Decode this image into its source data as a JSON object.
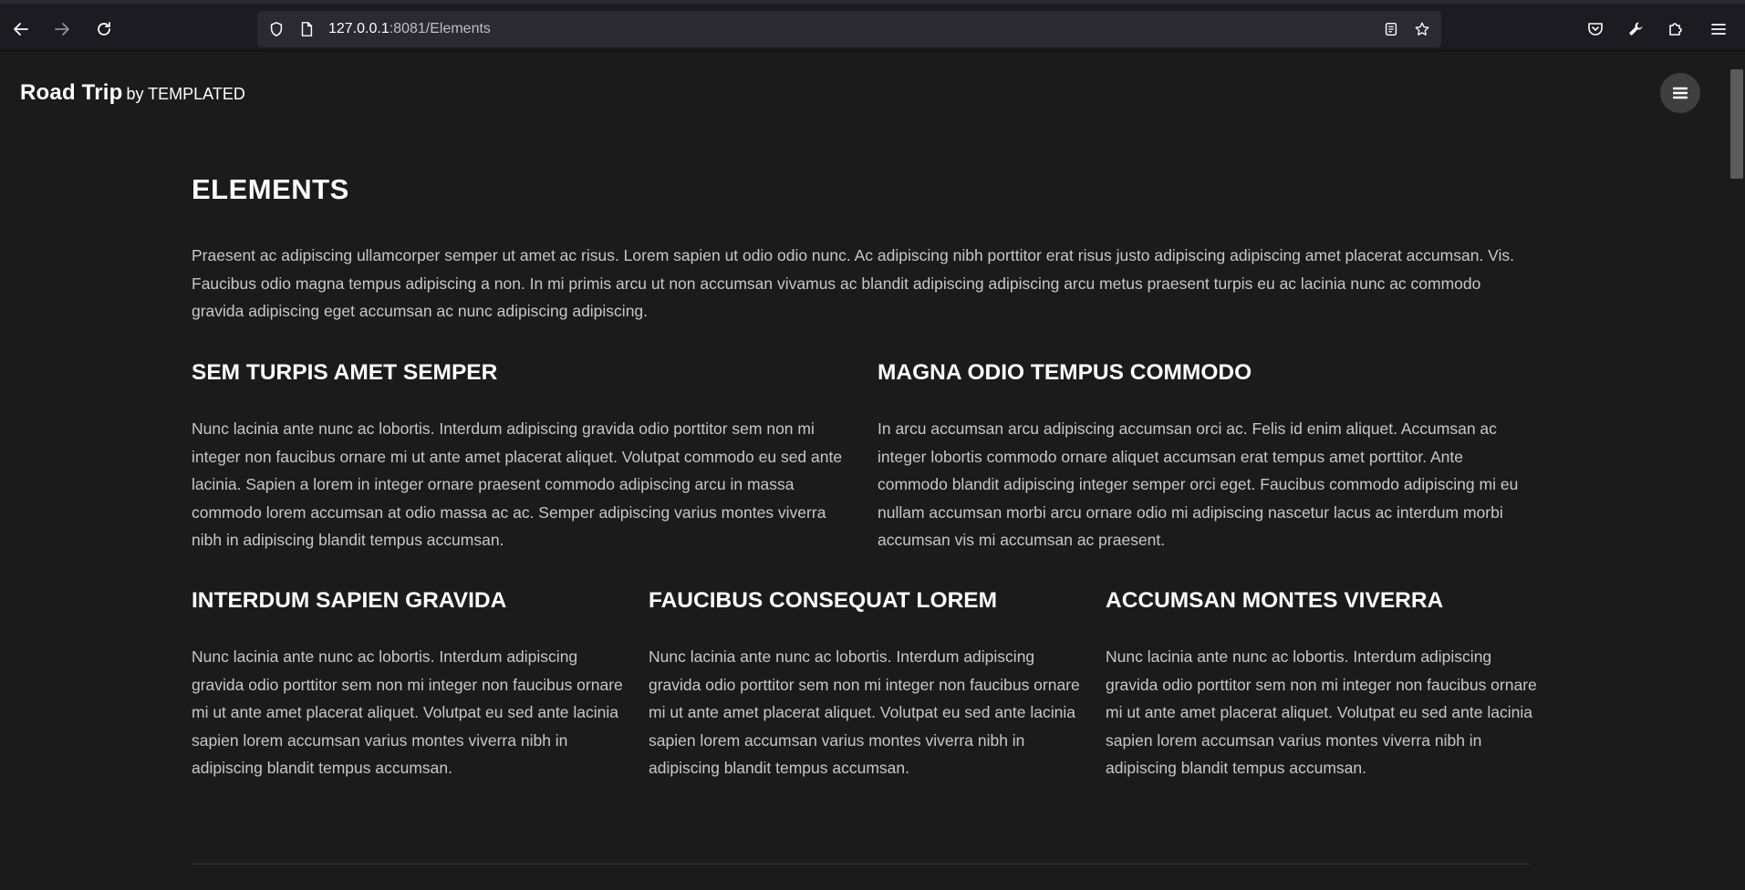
{
  "browser": {
    "url_host": "127.0.0.1",
    "url_rest": ":8081/Elements"
  },
  "site": {
    "brand_name": "Road Trip",
    "brand_by": "by TEMPLATED"
  },
  "main": {
    "title": "ELEMENTS",
    "intro": "Praesent ac adipiscing ullamcorper semper ut amet ac risus. Lorem sapien ut odio odio nunc. Ac adipiscing nibh porttitor erat risus justo adipiscing adipiscing amet placerat accumsan. Vis. Faucibus odio magna tempus adipiscing a non. In mi primis arcu ut non accumsan vivamus ac blandit adipiscing adipiscing arcu metus praesent turpis eu ac lacinia nunc ac commodo gravida adipiscing eget accumsan ac nunc adipiscing adipiscing.",
    "two_col": [
      {
        "title": "SEM TURPIS AMET SEMPER",
        "text": "Nunc lacinia ante nunc ac lobortis. Interdum adipiscing gravida odio porttitor sem non mi integer non faucibus ornare mi ut ante amet placerat aliquet. Volutpat commodo eu sed ante lacinia. Sapien a lorem in integer ornare praesent commodo adipiscing arcu in massa commodo lorem accumsan at odio massa ac ac. Semper adipiscing varius montes viverra nibh in adipiscing blandit tempus accumsan."
      },
      {
        "title": "MAGNA ODIO TEMPUS COMMODO",
        "text": "In arcu accumsan arcu adipiscing accumsan orci ac. Felis id enim aliquet. Accumsan ac integer lobortis commodo ornare aliquet accumsan erat tempus amet porttitor. Ante commodo blandit adipiscing integer semper orci eget. Faucibus commodo adipiscing mi eu nullam accumsan morbi arcu ornare odio mi adipiscing nascetur lacus ac interdum morbi accumsan vis mi accumsan ac praesent."
      }
    ],
    "three_col": [
      {
        "title": "INTERDUM SAPIEN GRAVIDA",
        "text": "Nunc lacinia ante nunc ac lobortis. Interdum adipiscing gravida odio porttitor sem non mi integer non faucibus ornare mi ut ante amet placerat aliquet. Volutpat eu sed ante lacinia sapien lorem accumsan varius montes viverra nibh in adipiscing blandit tempus accumsan."
      },
      {
        "title": "FAUCIBUS CONSEQUAT LOREM",
        "text": "Nunc lacinia ante nunc ac lobortis. Interdum adipiscing gravida odio porttitor sem non mi integer non faucibus ornare mi ut ante amet placerat aliquet. Volutpat eu sed ante lacinia sapien lorem accumsan varius montes viverra nibh in adipiscing blandit tempus accumsan."
      },
      {
        "title": "ACCUMSAN MONTES VIVERRA",
        "text": "Nunc lacinia ante nunc ac lobortis. Interdum adipiscing gravida odio porttitor sem non mi integer non faucibus ornare mi ut ante amet placerat aliquet. Volutpat eu sed ante lacinia sapien lorem accumsan varius montes viverra nibh in adipiscing blandit tempus accumsan."
      }
    ]
  }
}
